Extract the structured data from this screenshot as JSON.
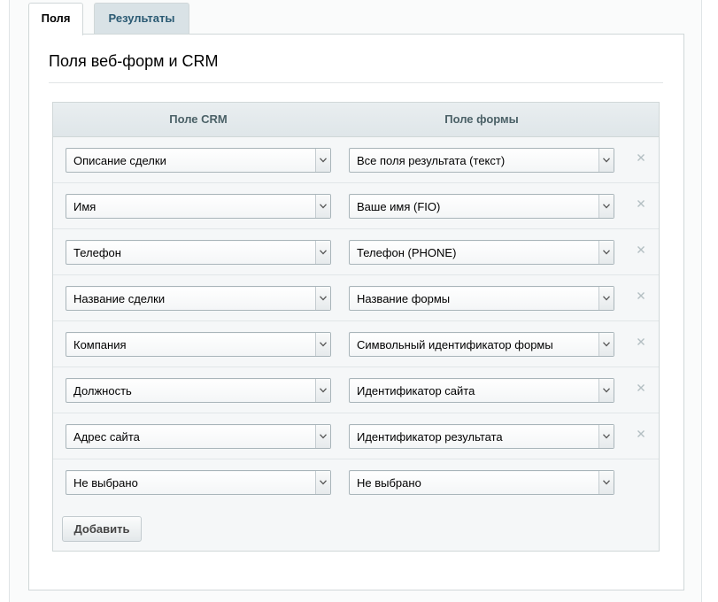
{
  "tabs": [
    {
      "label": "Поля",
      "active": true
    },
    {
      "label": "Результаты",
      "active": false
    }
  ],
  "panel": {
    "title": "Поля веб-форм и CRM"
  },
  "grid": {
    "columns": {
      "crm": "Поле CRM",
      "form": "Поле формы"
    },
    "rows": [
      {
        "crm": "Описание сделки",
        "form": "Все поля результата (текст)",
        "removable": true
      },
      {
        "crm": "Имя",
        "form": "Ваше имя (FIO)",
        "removable": true
      },
      {
        "crm": "Телефон",
        "form": "Телефон (PHONE)",
        "removable": true
      },
      {
        "crm": "Название сделки",
        "form": "Название формы",
        "removable": true
      },
      {
        "crm": "Компания",
        "form": "Символьный идентификатор формы",
        "removable": true
      },
      {
        "crm": "Должность",
        "form": "Идентификатор сайта",
        "removable": true
      },
      {
        "crm": "Адрес сайта",
        "form": "Идентификатор результата",
        "removable": true
      },
      {
        "crm": "Не выбрано",
        "form": "Не выбрано",
        "removable": false
      }
    ],
    "add_label": "Добавить"
  },
  "icons": {
    "remove": "close-icon",
    "dropdown": "chevron-down-icon"
  },
  "colors": {
    "inactive_tab_bg": "#d9e2e6",
    "inactive_tab_text": "#2b5a73",
    "header_text": "#4b6167",
    "remove_icon": "#b3bec2"
  }
}
